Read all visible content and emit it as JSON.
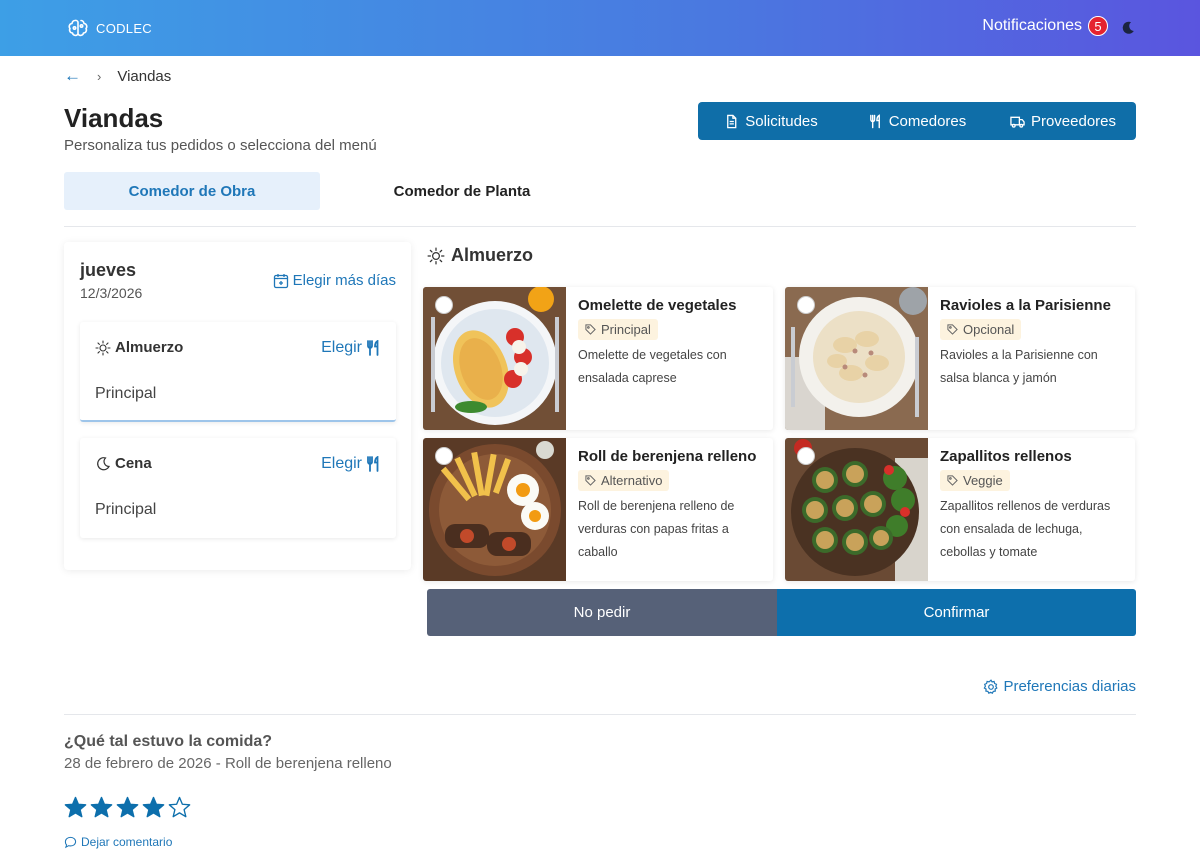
{
  "app": {
    "brand": "CODLEC"
  },
  "header": {
    "notifications_label": "Notificaciones",
    "notifications_count": "5"
  },
  "breadcrumb": {
    "current": "Viandas"
  },
  "page": {
    "title": "Viandas",
    "subtitle": "Personaliza tus pedidos o selecciona del menú"
  },
  "actions": {
    "solicitudes": "Solicitudes",
    "comedores": "Comedores",
    "proveedores": "Proveedores"
  },
  "tabs": [
    {
      "label": "Comedor de Obra",
      "active": true
    },
    {
      "label": "Comedor de Planta",
      "active": false
    }
  ],
  "day": {
    "name": "jueves",
    "date": "12/3/2026",
    "more_days": "Elegir más días",
    "meals": [
      {
        "name": "Almuerzo",
        "choose": "Elegir",
        "value": "Principal"
      },
      {
        "name": "Cena",
        "choose": "Elegir",
        "value": "Principal"
      }
    ]
  },
  "menu": {
    "section": "Almuerzo",
    "dishes": [
      {
        "title": "Omelette de vegetales",
        "tag": "Principal",
        "desc": "Omelette de vegetales con ensalada caprese"
      },
      {
        "title": "Ravioles a la Parisienne",
        "tag": "Opcional",
        "desc": "Ravioles a la Parisienne con salsa blanca y jamón"
      },
      {
        "title": "Roll de berenjena relleno",
        "tag": "Alternativo",
        "desc": "Roll de berenjena relleno de verduras con papas fritas a caballo"
      },
      {
        "title": "Zapallitos rellenos",
        "tag": "Veggie",
        "desc": "Zapallitos rellenos de verduras con ensalada de lechuga, cebollas y tomate"
      }
    ],
    "no_order": "No pedir",
    "confirm": "Confirmar"
  },
  "preferences": "Preferencias diarias",
  "rating": {
    "question": "¿Qué tal estuvo la comida?",
    "subtitle": "28 de febrero de 2026 - Roll de berenjena relleno",
    "stars": 4,
    "max_stars": 5,
    "comment": "Dejar comentario"
  },
  "colors": {
    "primary": "#0d6fac",
    "accent": "#1f77b8",
    "secondary_button": "#566178",
    "badge": "#e5232f"
  }
}
